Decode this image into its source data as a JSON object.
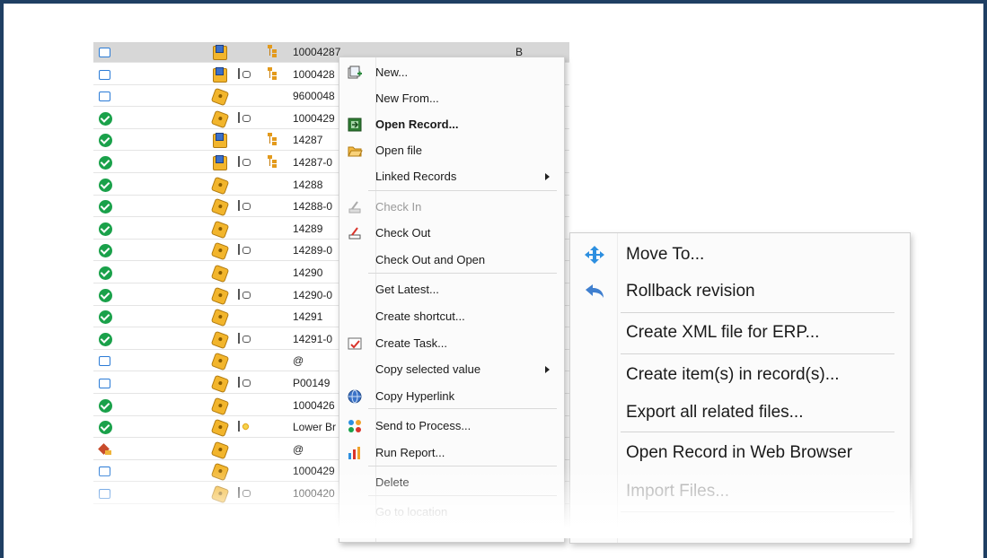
{
  "grid": {
    "rows": [
      {
        "status": "empty",
        "type": "asm",
        "link": false,
        "tree": true,
        "number": "10004287",
        "rev": "B",
        "selected": true
      },
      {
        "status": "empty",
        "type": "asm",
        "link": true,
        "tree": true,
        "number": "1000428",
        "rev": ""
      },
      {
        "status": "empty",
        "type": "part",
        "link": false,
        "tree": false,
        "number": "9600048",
        "rev": ""
      },
      {
        "status": "ok",
        "type": "part",
        "link": true,
        "tree": false,
        "number": "1000429",
        "rev": ""
      },
      {
        "status": "ok",
        "type": "asm",
        "link": false,
        "tree": true,
        "number": "14287",
        "rev": ""
      },
      {
        "status": "ok",
        "type": "asm",
        "link": true,
        "tree": true,
        "number": "14287-0",
        "rev": ""
      },
      {
        "status": "ok",
        "type": "part",
        "link": false,
        "tree": false,
        "number": "14288",
        "rev": ""
      },
      {
        "status": "ok",
        "type": "part",
        "link": true,
        "tree": false,
        "number": "14288-0",
        "rev": ""
      },
      {
        "status": "ok",
        "type": "part",
        "link": false,
        "tree": false,
        "number": "14289",
        "rev": ""
      },
      {
        "status": "ok",
        "type": "part",
        "link": true,
        "tree": false,
        "number": "14289-0",
        "rev": ""
      },
      {
        "status": "ok",
        "type": "part",
        "link": false,
        "tree": false,
        "number": "14290",
        "rev": ""
      },
      {
        "status": "ok",
        "type": "part",
        "link": true,
        "tree": false,
        "number": "14290-0",
        "rev": ""
      },
      {
        "status": "ok",
        "type": "part",
        "link": false,
        "tree": false,
        "number": "14291",
        "rev": ""
      },
      {
        "status": "ok",
        "type": "part",
        "link": true,
        "tree": false,
        "number": "14291-0",
        "rev": ""
      },
      {
        "status": "empty",
        "type": "part",
        "link": false,
        "tree": false,
        "number": "@",
        "rev": ""
      },
      {
        "status": "empty",
        "type": "part",
        "link": true,
        "tree": false,
        "number": "P00149",
        "rev": ""
      },
      {
        "status": "ok",
        "type": "part",
        "link": false,
        "tree": false,
        "number": "1000426",
        "rev": ""
      },
      {
        "status": "ok",
        "type": "part",
        "link": "gold",
        "tree": false,
        "number": "Lower Br",
        "rev": ""
      },
      {
        "status": "warn",
        "type": "part",
        "link": false,
        "tree": false,
        "number": "@",
        "rev": ""
      },
      {
        "status": "empty",
        "type": "part",
        "link": false,
        "tree": false,
        "number": "1000429",
        "rev": ""
      },
      {
        "status": "empty",
        "type": "part",
        "link": true,
        "tree": false,
        "number": "1000420",
        "rev": ""
      }
    ]
  },
  "context_menu": {
    "items": [
      {
        "label": "New...",
        "icon": "new-record-icon",
        "style": "normal",
        "arrow": false
      },
      {
        "label": "New From...",
        "icon": "",
        "style": "normal",
        "arrow": false
      },
      {
        "label": "Open Record...",
        "icon": "open-record-icon",
        "style": "bold",
        "arrow": false
      },
      {
        "label": "Open file",
        "icon": "open-folder-icon",
        "style": "normal",
        "arrow": false
      },
      {
        "label": "Linked Records",
        "icon": "",
        "style": "normal",
        "arrow": true
      },
      {
        "label": "Check In",
        "icon": "check-in-icon",
        "style": "disabled",
        "arrow": false
      },
      {
        "label": "Check Out",
        "icon": "check-out-icon",
        "style": "normal",
        "arrow": false
      },
      {
        "label": "Check Out and Open",
        "icon": "",
        "style": "normal",
        "arrow": false
      },
      {
        "label": "Get Latest...",
        "icon": "",
        "style": "normal",
        "arrow": false
      },
      {
        "label": "Create shortcut...",
        "icon": "",
        "style": "normal",
        "arrow": false
      },
      {
        "label": "Create Task...",
        "icon": "task-icon",
        "style": "normal",
        "arrow": false
      },
      {
        "label": "Copy selected value",
        "icon": "",
        "style": "normal",
        "arrow": true
      },
      {
        "label": "Copy Hyperlink",
        "icon": "hyperlink-icon",
        "style": "normal",
        "arrow": false
      },
      {
        "label": "Send to Process...",
        "icon": "process-icon",
        "style": "normal",
        "arrow": false
      },
      {
        "label": "Run Report...",
        "icon": "report-icon",
        "style": "normal",
        "arrow": false
      },
      {
        "label": "Delete",
        "icon": "",
        "style": "normal",
        "arrow": false
      },
      {
        "label": "Go to location",
        "icon": "",
        "style": "disabled",
        "arrow": false
      }
    ]
  },
  "submenu": {
    "items": [
      {
        "label": "Move To...",
        "icon": "move-icon",
        "style": "normal"
      },
      {
        "label": "Rollback revision",
        "icon": "rollback-icon",
        "style": "normal"
      },
      {
        "label": "Create XML file for ERP...",
        "icon": "",
        "style": "normal"
      },
      {
        "label": "Create item(s) in record(s)...",
        "icon": "",
        "style": "normal"
      },
      {
        "label": "Export all related files...",
        "icon": "",
        "style": "normal"
      },
      {
        "label": "Open Record in Web Browser",
        "icon": "",
        "style": "normal"
      },
      {
        "label": "Import Files...",
        "icon": "",
        "style": "disabled"
      }
    ]
  },
  "colors": {
    "frame": "#1f3f63",
    "ok": "#1aa14a",
    "selected_row": "#d7d7d7",
    "part": "#f2b52c",
    "move_icon": "#2d8fe0"
  }
}
